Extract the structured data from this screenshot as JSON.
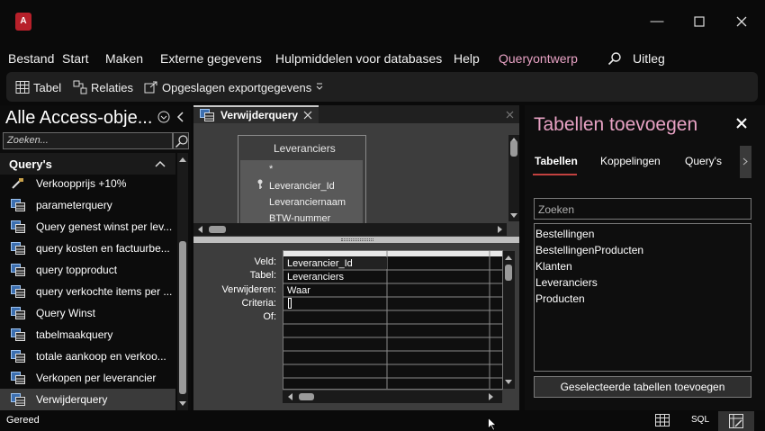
{
  "menu": {
    "items": [
      "Bestand",
      "Start",
      "Maken",
      "Externe gegevens",
      "Hulpmiddelen voor databases",
      "Help",
      "Queryontwerp"
    ],
    "tell_me": "Uitleg"
  },
  "toolbar": {
    "table_label": "Tabel",
    "relations_label": "Relaties",
    "saved_exports_label": "Opgeslagen exportgegevens"
  },
  "nav": {
    "title": "Alle Access-obje...",
    "search_placeholder": "Zoeken...",
    "group_label": "Query's",
    "items": [
      "Verkoopprijs +10%",
      "parameterquery",
      "Query genest winst per lev...",
      "query kosten en factuurbe...",
      "query topproduct",
      "query verkochte items per ...",
      "Query Winst",
      "tabelmaakquery",
      "totale aankoop en verkoo...",
      "Verkopen per leverancier",
      "Verwijderquery"
    ]
  },
  "document": {
    "tab_label": "Verwijderquery",
    "table_title": "Leveranciers",
    "fields": [
      "*",
      "Leverancier_Id",
      "Leveranciernaam",
      "BTW-nummer"
    ],
    "grid_labels": [
      "Veld:",
      "Tabel:",
      "Verwijderen:",
      "Criteria:",
      "Of:"
    ],
    "grid_values": [
      "Leverancier_Id",
      "Leveranciers",
      "Waar",
      ""
    ]
  },
  "right_pane": {
    "title": "Tabellen toevoegen",
    "tabs": [
      "Tabellen",
      "Koppelingen",
      "Query's"
    ],
    "search_placeholder": "Zoeken",
    "tables": [
      "Bestellingen",
      "BestellingenProducten",
      "Klanten",
      "Leveranciers",
      "Producten"
    ],
    "add_button": "Geselecteerde tabellen toevoegen"
  },
  "status": {
    "text": "Gereed",
    "sql_label": "SQL"
  },
  "colors": {
    "accent": "#e8a2c4",
    "access_red": "#b7202a",
    "tab_underline": "#c2413f"
  }
}
